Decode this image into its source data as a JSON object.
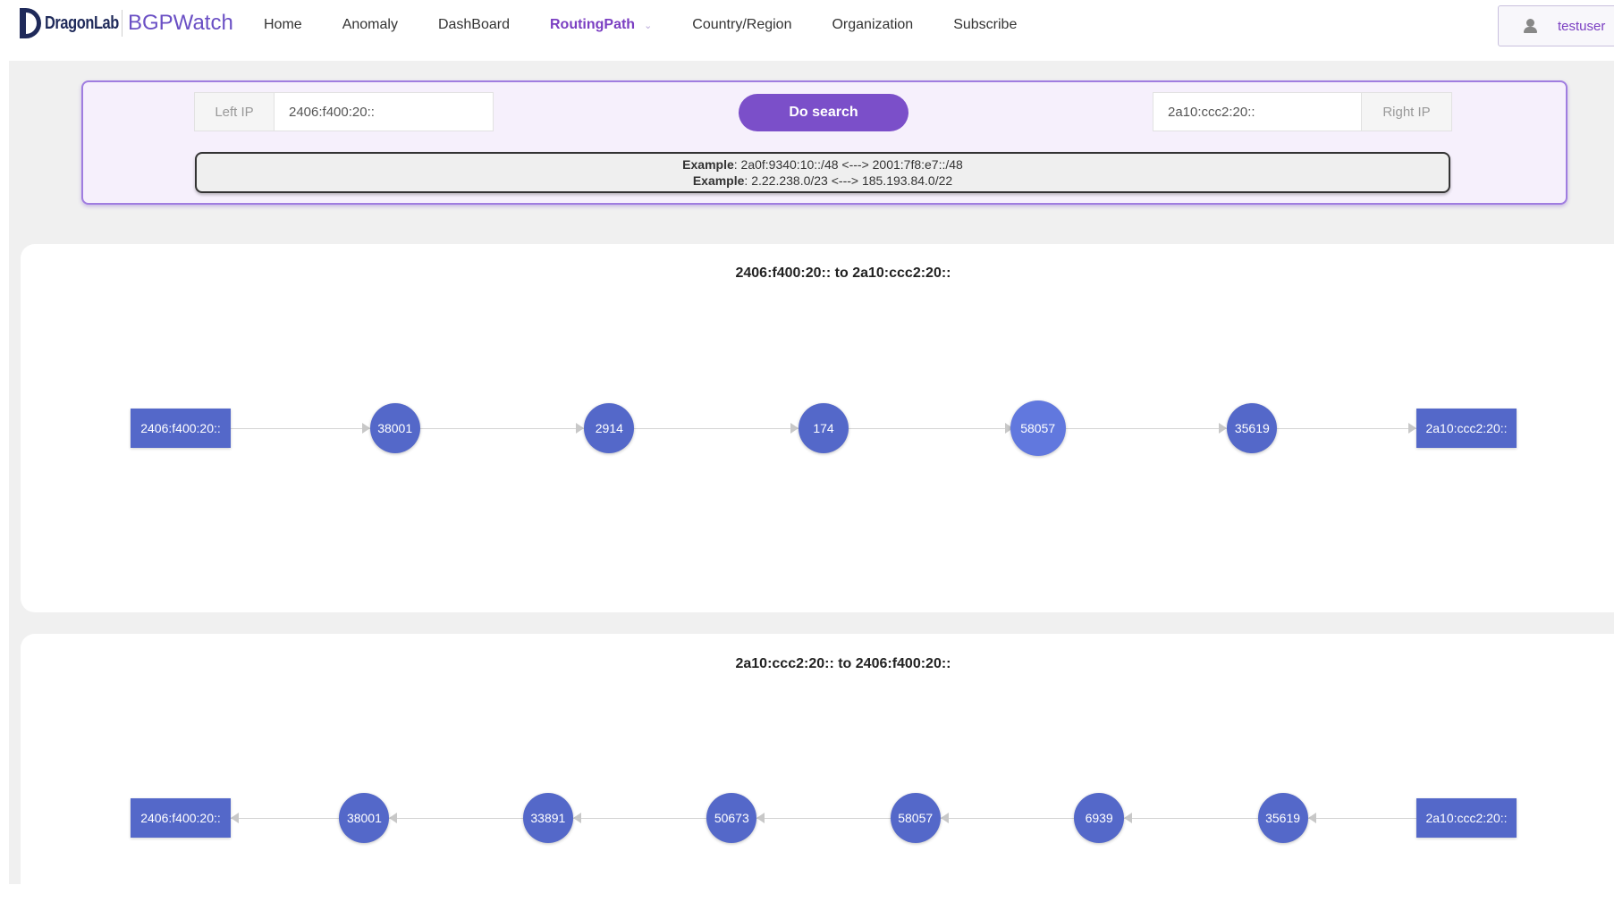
{
  "header": {
    "logo_text": "DragonLab",
    "product": "BGPWatch",
    "nav": [
      "Home",
      "Anomaly",
      "DashBoard",
      "RoutingPath",
      "Country/Region",
      "Organization",
      "Subscribe"
    ],
    "active_nav": "RoutingPath",
    "user": "testuser"
  },
  "search": {
    "left_label": "Left IP",
    "left_value": "2406:f400:20::",
    "button": "Do search",
    "right_value": "2a10:ccc2:20::",
    "right_label": "Right IP",
    "examples": [
      {
        "label": "Example",
        "text": ": 2a0f:9340:10::/48 <---> 2001:7f8:e7::/48"
      },
      {
        "label": "Example",
        "text": ": 2.22.238.0/23 <---> 185.193.84.0/22"
      }
    ]
  },
  "paths": [
    {
      "title": "2406:f400:20:: to 2a10:ccc2:20::",
      "direction": "right",
      "left_ip": "2406:f400:20::",
      "right_ip": "2a10:ccc2:20::",
      "hops": [
        "38001",
        "2914",
        "174",
        "58057",
        "35619"
      ],
      "highlight": "58057"
    },
    {
      "title": "2a10:ccc2:20:: to 2406:f400:20::",
      "direction": "left",
      "left_ip": "2406:f400:20::",
      "right_ip": "2a10:ccc2:20::",
      "hops": [
        "38001",
        "33891",
        "50673",
        "58057",
        "6939",
        "35619"
      ],
      "highlight": ""
    }
  ],
  "colors": {
    "accent": "#7b4fc9",
    "node": "#5468c9",
    "node_highlight": "#6178de"
  }
}
